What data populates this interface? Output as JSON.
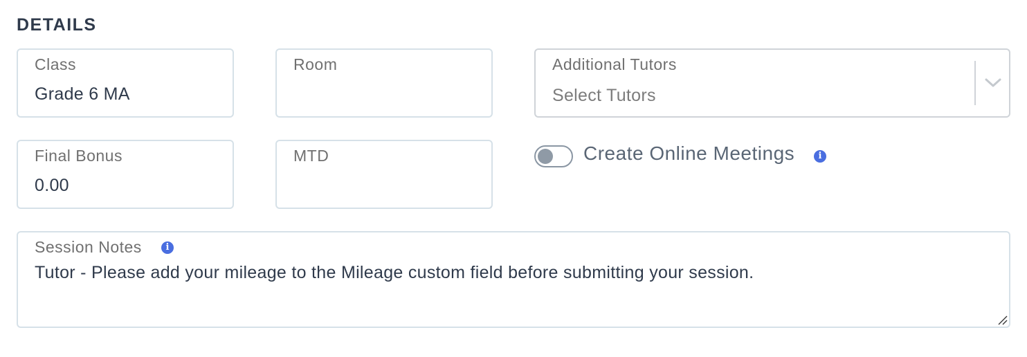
{
  "section": {
    "title": "DETAILS"
  },
  "fields": {
    "class": {
      "label": "Class",
      "value": "Grade 6 MA"
    },
    "room": {
      "label": "Room",
      "value": ""
    },
    "additional_tutors": {
      "label": "Additional Tutors",
      "placeholder": "Select Tutors",
      "icon": "chevron-down-icon"
    },
    "final_bonus": {
      "label": "Final Bonus",
      "value": "0.00"
    },
    "mtd": {
      "label": "MTD",
      "value": ""
    },
    "session_notes": {
      "label": "Session Notes",
      "value": "Tutor - Please add your mileage to the Mileage custom field before submitting your session.",
      "icon": "info-icon"
    }
  },
  "toggle": {
    "label": "Create Online Meetings",
    "state": "off",
    "icon": "info-icon"
  },
  "colors": {
    "accent": "#4a6ee0",
    "border": "#d6e1e8",
    "text": "#2f3a4b",
    "label": "#707070"
  }
}
